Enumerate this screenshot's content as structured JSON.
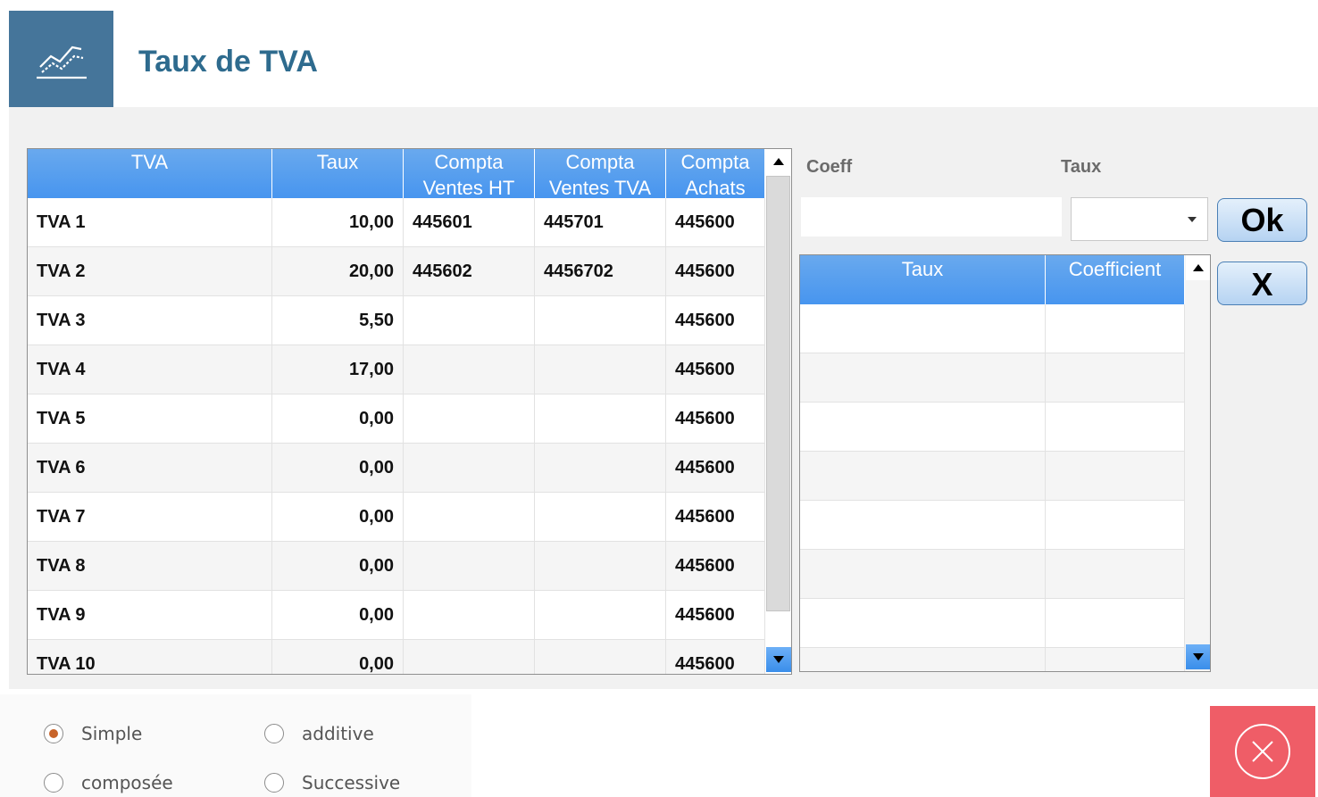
{
  "header": {
    "title": "Taux de TVA",
    "icon": "chart-line-icon"
  },
  "main_table": {
    "columns": [
      {
        "label": "TVA"
      },
      {
        "label": "Taux"
      },
      {
        "label": "Compta\nVentes HT"
      },
      {
        "label": "Compta\nVentes TVA"
      },
      {
        "label": "Compta\nAchats"
      }
    ],
    "rows": [
      {
        "tva": "TVA 1",
        "taux": "10,00",
        "ventes_ht": "445601",
        "ventes_tva": "445701",
        "achats": "445600"
      },
      {
        "tva": "TVA 2",
        "taux": "20,00",
        "ventes_ht": "445602",
        "ventes_tva": "4456702",
        "achats": "445600"
      },
      {
        "tva": "TVA 3",
        "taux": "5,50",
        "ventes_ht": "",
        "ventes_tva": "",
        "achats": "445600"
      },
      {
        "tva": "TVA 4",
        "taux": "17,00",
        "ventes_ht": "",
        "ventes_tva": "",
        "achats": "445600"
      },
      {
        "tva": "TVA 5",
        "taux": "0,00",
        "ventes_ht": "",
        "ventes_tva": "",
        "achats": "445600"
      },
      {
        "tva": "TVA 6",
        "taux": "0,00",
        "ventes_ht": "",
        "ventes_tva": "",
        "achats": "445600"
      },
      {
        "tva": "TVA 7",
        "taux": "0,00",
        "ventes_ht": "",
        "ventes_tva": "",
        "achats": "445600"
      },
      {
        "tva": "TVA 8",
        "taux": "0,00",
        "ventes_ht": "",
        "ventes_tva": "",
        "achats": "445600"
      },
      {
        "tva": "TVA 9",
        "taux": "0,00",
        "ventes_ht": "",
        "ventes_tva": "",
        "achats": "445600"
      },
      {
        "tva": "TVA 10",
        "taux": "0,00",
        "ventes_ht": "",
        "ventes_tva": "",
        "achats": "445600"
      }
    ]
  },
  "form": {
    "coeff_label": "Coeff",
    "taux_label": "Taux",
    "coeff_value": "",
    "taux_value": "",
    "ok_label": "Ok",
    "cancel_label": "X"
  },
  "coef_table": {
    "columns": [
      {
        "label": "Taux"
      },
      {
        "label": "Coefficient"
      }
    ],
    "row_count": 8
  },
  "options": {
    "simple": "Simple",
    "additive": "additive",
    "composee": "composée",
    "successive": "Successive",
    "selected": "simple"
  },
  "colors": {
    "header_icon_bg": "#45759a",
    "title": "#2e6b8e",
    "grid_header": "#4795ef",
    "close_bg": "#ef5d67",
    "radio_selected": "#c8642a"
  }
}
